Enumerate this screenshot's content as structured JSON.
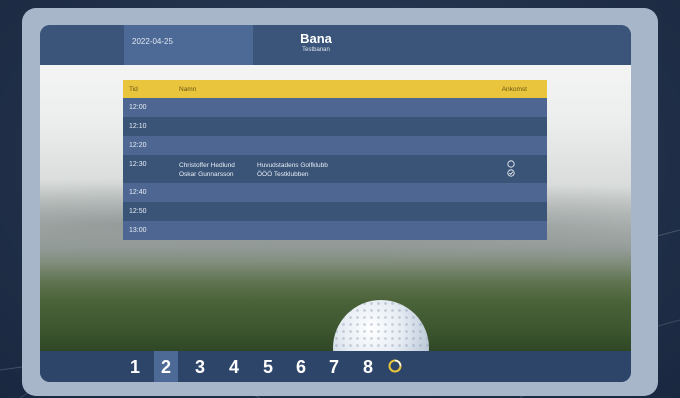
{
  "header": {
    "date": "2022-04-25",
    "course_title": "Bana",
    "course_subtitle": "Testbanan"
  },
  "table": {
    "columns": [
      "Tid",
      "Namn",
      "Ankomst"
    ],
    "rows": [
      {
        "time": "12:00",
        "players": []
      },
      {
        "time": "12:10",
        "players": []
      },
      {
        "time": "12:20",
        "players": []
      },
      {
        "time": "12:30",
        "players": [
          {
            "name": "Christoffer Hedlund",
            "club": "Huvudstadens Golfklubb",
            "arrival": "not-arrived"
          },
          {
            "name": "Oskar Gunnarsson",
            "club": "ÖÖÖ Testklubben",
            "arrival": "arrived"
          }
        ]
      },
      {
        "time": "12:40",
        "players": []
      },
      {
        "time": "12:50",
        "players": []
      },
      {
        "time": "13:00",
        "players": []
      }
    ]
  },
  "tabs": {
    "numbers": [
      "1",
      "2",
      "3",
      "4",
      "5",
      "6",
      "7",
      "8"
    ],
    "active_index": 1,
    "loader_icon": "spinner-icon"
  },
  "colors": {
    "accent_yellow": "#e8c53c",
    "row_light": "#4d6792",
    "row_dark": "#3a5478",
    "bar": "#3b557a"
  }
}
